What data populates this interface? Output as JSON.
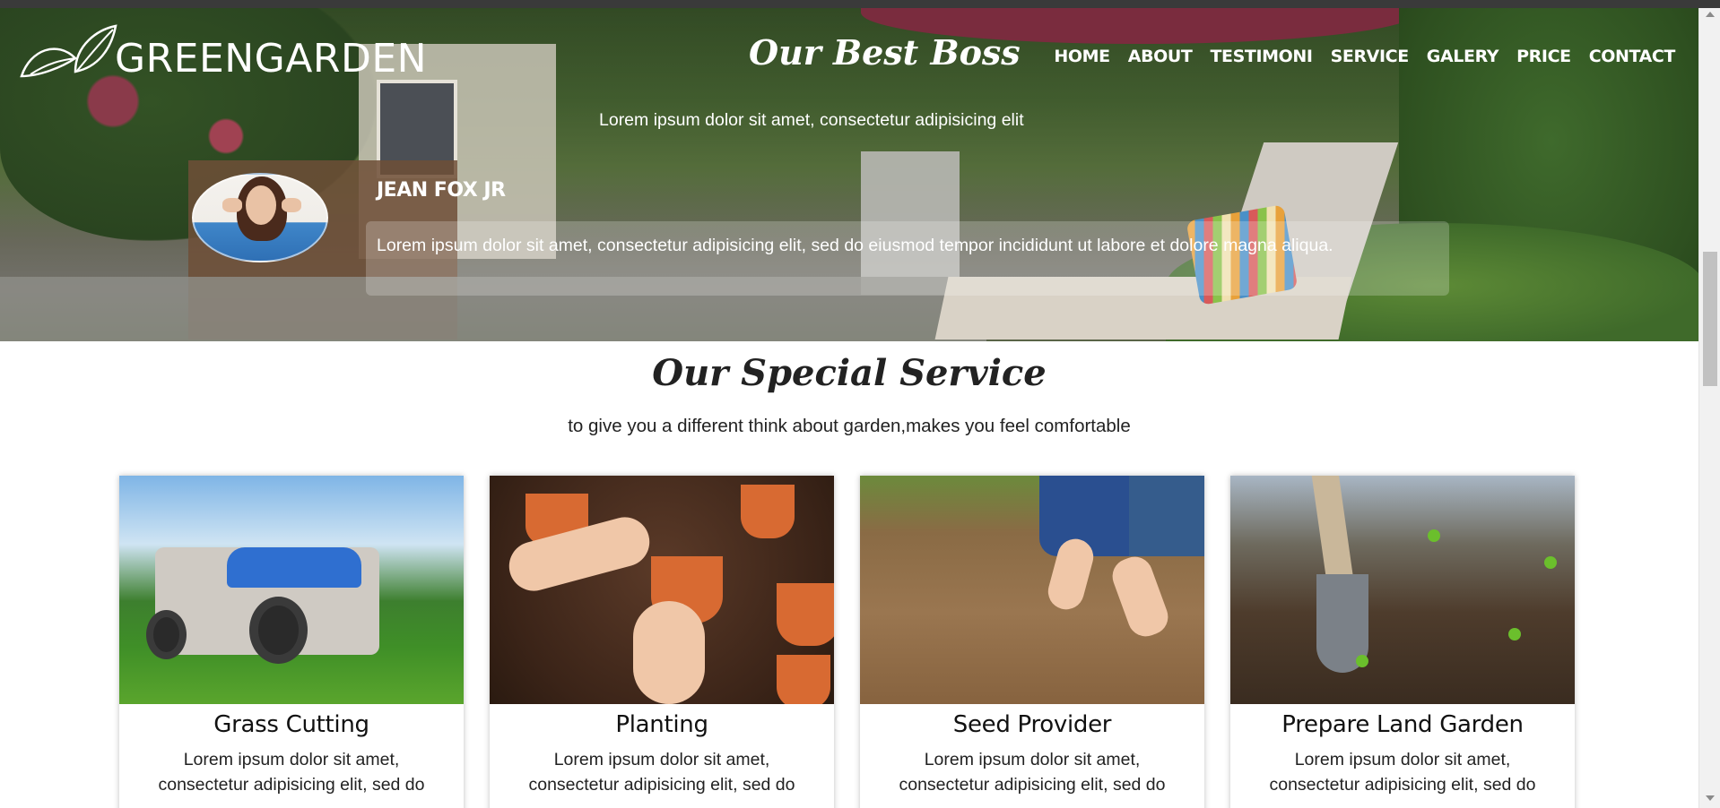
{
  "brand": {
    "name": "GREENGARDEN"
  },
  "hero": {
    "heading": "Our Best Boss",
    "subheading": "Lorem ipsum dolor sit amet, consectetur adipisicing elit",
    "testimonial": {
      "name": "JEAN FOX JR",
      "text": "Lorem ipsum dolor sit amet, consectetur adipisicing elit, sed do eiusmod tempor incididunt ut labore et dolore magna aliqua."
    }
  },
  "nav": {
    "items": [
      {
        "label": "HOME"
      },
      {
        "label": "ABOUT"
      },
      {
        "label": "TESTIMONI"
      },
      {
        "label": "SERVICE"
      },
      {
        "label": "GALERY"
      },
      {
        "label": "PRICE"
      },
      {
        "label": "CONTACT"
      }
    ]
  },
  "services": {
    "title": "Our Special Service",
    "subtitle": "to give you a different think about garden,makes you feel comfortable",
    "cards": [
      {
        "title": "Grass Cutting",
        "text": "Lorem ipsum dolor sit amet, consectetur adipisicing elit, sed do",
        "image_icon": "lawn-mower-photo"
      },
      {
        "title": "Planting",
        "text": "Lorem ipsum dolor sit amet, consectetur adipisicing elit, sed do",
        "image_icon": "potted-plant-photo"
      },
      {
        "title": "Seed Provider",
        "text": "Lorem ipsum dolor sit amet, consectetur adipisicing elit, sed do",
        "image_icon": "planting-seeds-photo"
      },
      {
        "title": "Prepare Land Garden",
        "text": "Lorem ipsum dolor sit amet, consectetur adipisicing elit, sed do",
        "image_icon": "garden-spade-photo"
      }
    ]
  },
  "colors": {
    "text_dark": "#222222",
    "white": "#ffffff",
    "scroll_thumb": "#c1c1c1"
  }
}
